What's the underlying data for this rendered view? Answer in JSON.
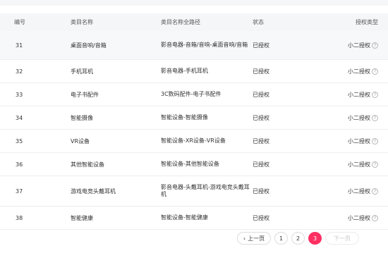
{
  "table": {
    "headers": [
      "编号",
      "类目名称",
      "类目名称全路径",
      "状态",
      "授权类型"
    ],
    "rows": [
      {
        "id": "31",
        "name": "桌面音响/音箱",
        "path": "影音电器-音箱/音响-桌面音响/音箱",
        "status": "已授权",
        "auth": "小二授权"
      },
      {
        "id": "32",
        "name": "手机耳机",
        "path": "影音电器-手机耳机",
        "status": "已授权",
        "auth": "小二授权"
      },
      {
        "id": "33",
        "name": "电子书配件",
        "path": "3C数码配件-电子书配件",
        "status": "已授权",
        "auth": "小二授权"
      },
      {
        "id": "34",
        "name": "智能摄像",
        "path": "智能设备-智能摄像",
        "status": "已授权",
        "auth": "小二授权"
      },
      {
        "id": "35",
        "name": "VR设备",
        "path": "智能设备-XR设备-VR设备",
        "status": "已授权",
        "auth": "小二授权"
      },
      {
        "id": "36",
        "name": "其他智能设备",
        "path": "智能设备-其他智能设备",
        "status": "已授权",
        "auth": "小二授权"
      },
      {
        "id": "37",
        "name": "游戏电竞头戴耳机",
        "path": "影音电器-头戴耳机-游戏电竞头戴耳机",
        "status": "已授权",
        "auth": "小二授权"
      },
      {
        "id": "38",
        "name": "智能健康",
        "path": "智能设备-智能健康",
        "status": "已授权",
        "auth": "小二授权"
      }
    ],
    "info_glyph": "?"
  },
  "pagination": {
    "prev_label": "上一页",
    "prev_chevron": "‹",
    "pages": [
      "1",
      "2",
      "3"
    ],
    "current": "3",
    "next_label": "下一页"
  },
  "colors": {
    "accent": "#ff2f62",
    "header_bg": "#f5f6f8"
  }
}
